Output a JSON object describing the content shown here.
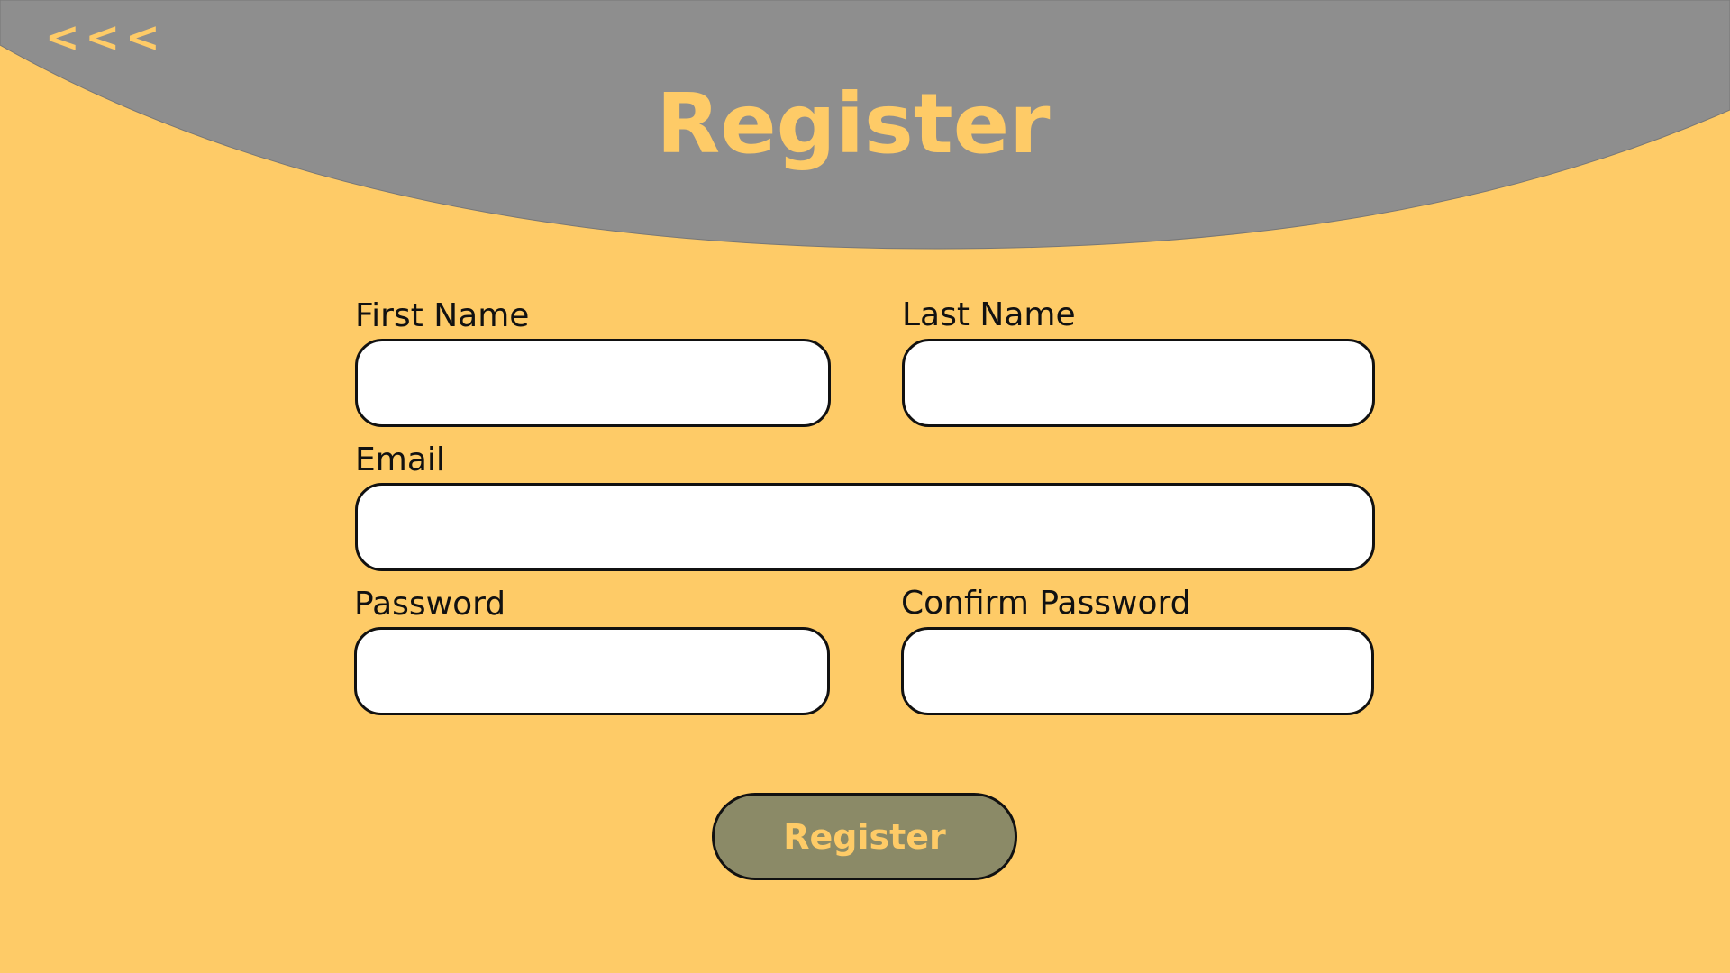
{
  "header": {
    "back_label": "<<<",
    "title": "Register",
    "background_color": "#8E8E8E"
  },
  "form": {
    "first_name_label": "First Name",
    "first_name_value": "",
    "last_name_label": "Last Name",
    "last_name_value": "",
    "email_label": "Email",
    "email_value": "",
    "password_label": "Password",
    "password_value": "",
    "confirm_password_label": "Confirm Password",
    "confirm_password_value": "",
    "submit_label": "Register"
  },
  "colors": {
    "page_background": "#FECB67",
    "accent_text": "#FECB67",
    "button_background": "#8B8A67",
    "input_background": "#FFFFFF",
    "border": "#111111"
  }
}
